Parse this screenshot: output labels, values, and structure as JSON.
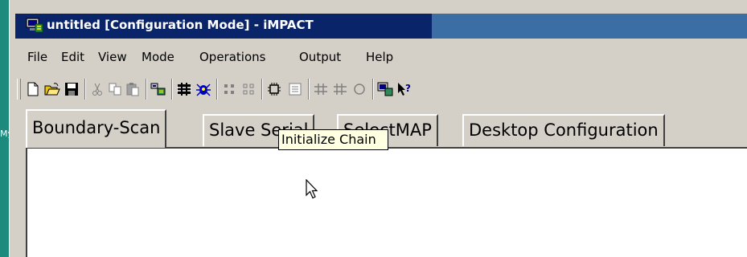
{
  "window": {
    "title": "untitled [Configuration Mode]  - iMPACT",
    "icon": "impact-app-icon"
  },
  "desktop": {
    "strip_text": "My"
  },
  "menu": {
    "items": [
      "File",
      "Edit",
      "View",
      "Mode",
      "Operations",
      "Output",
      "Help"
    ]
  },
  "toolbar": {
    "buttons": [
      "new-file-icon",
      "open-folder-icon",
      "save-icon",
      "cut-icon",
      "copy-icon",
      "paste-icon",
      "initialize-chain-icon",
      "chain-icon",
      "bug-icon",
      "grid-icon",
      "grid2-icon",
      "chip-icon",
      "list-icon",
      "program-icon",
      "program2-icon",
      "circle-icon",
      "monitor-icon",
      "whats-this-help-icon"
    ]
  },
  "tabs": {
    "items": [
      "Boundary-Scan",
      "Slave Serial",
      "SelectMAP",
      "Desktop Configuration"
    ],
    "active": "Boundary-Scan"
  },
  "tooltip": {
    "text": "Initialize Chain"
  },
  "colors": {
    "title_active": "#0a246a",
    "title_inactive": "#3a6ea5",
    "face": "#d4d0c8",
    "tooltip_bg": "#ffffe1",
    "desktop": "#1c8a7d"
  }
}
